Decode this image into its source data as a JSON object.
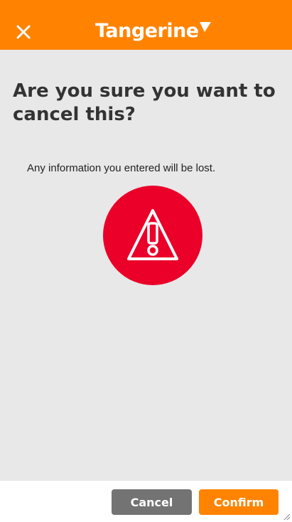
{
  "header": {
    "brand": "Tangerine",
    "close_icon": "close-icon",
    "background_color": "#ff8300"
  },
  "dialog": {
    "title": "Are you sure you want to cancel this?",
    "message": "Any information you entered will be lost.",
    "warning_icon": "warning-triangle-icon",
    "warning_color": "#ea0029"
  },
  "footer": {
    "cancel_label": "Cancel",
    "confirm_label": "Confirm",
    "cancel_color": "#737373",
    "confirm_color": "#ff8300"
  }
}
